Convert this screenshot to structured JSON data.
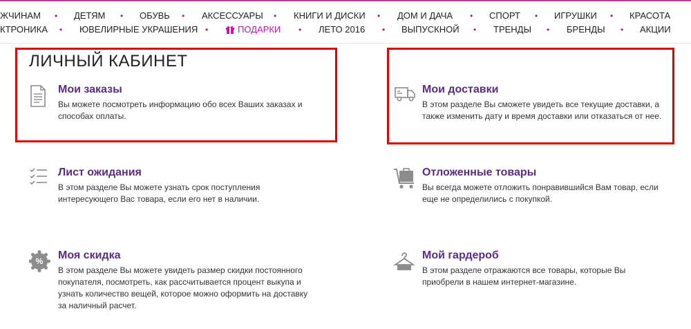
{
  "nav": {
    "row1": [
      "ЖЧИНАМ",
      "ДЕТЯМ",
      "ОБУВЬ",
      "АКСЕССУАРЫ",
      "КНИГИ И ДИСКИ",
      "ДОМ И ДАЧА",
      "СПОРТ",
      "ИГРУШКИ",
      "КРАСОТА"
    ],
    "row2": [
      "КТРОНИКА",
      "ЮВЕЛИРНЫЕ УКРАШЕНИЯ",
      "ПОДАРКИ",
      "ЛЕТО 2016",
      "ВЫПУСКНОЙ",
      "ТРЕНДЫ",
      "БРЕНДЫ",
      "АКЦИИ"
    ],
    "separator": "•"
  },
  "page": {
    "title": "ЛИЧНЫЙ КАБИНЕТ"
  },
  "cards": [
    {
      "icon": "document-icon",
      "title": "Мои заказы",
      "desc": "Вы можете посмотреть информацию обо всех Ваших заказах и способах оплаты."
    },
    {
      "icon": "truck-icon",
      "title": "Мои доставки",
      "desc": "В этом разделе Вы сможете увидеть все текущие доставки, а также изменить дату и время доставки или отказаться от нее."
    },
    {
      "icon": "checklist-icon",
      "title": "Лист ожидания",
      "desc": "В этом разделе Вы можете узнать срок поступления интересующего Вас товара, если его нет в наличии."
    },
    {
      "icon": "cart-icon",
      "title": "Отложенные товары",
      "desc": "Вы всегда можете отложить понравившийся Вам товар, если еще не определились с покупкой."
    },
    {
      "icon": "percent-icon",
      "title": "Моя скидка",
      "desc": "В этом разделе Вы можете увидеть размер скидки постоянного покупателя, посмотреть, как рассчитывается процент выкупа и узнать количество вещей, которое можно оформить на доставку за наличный расчет."
    },
    {
      "icon": "hanger-icon",
      "title": "Мой гардероб",
      "desc": "В этом разделе отражаются все товары, которые Вы приобрели в нашем интернет-магазине."
    }
  ],
  "colors": {
    "accent": "#5a2d82",
    "gift": "#cb11ab",
    "highlight": "#e10000",
    "icon": "#8c8c8c"
  }
}
